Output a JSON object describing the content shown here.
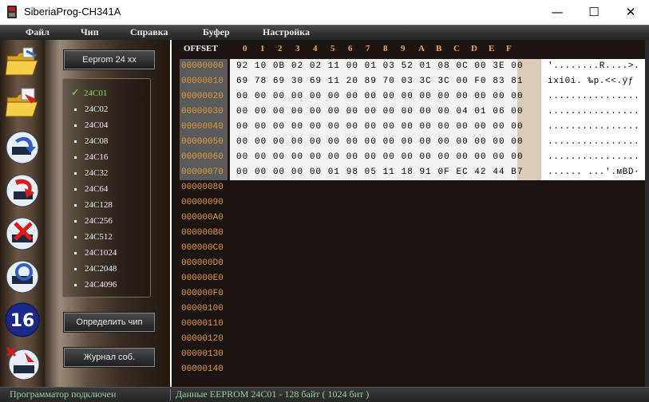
{
  "window": {
    "title": "SiberiaProg-CH341A"
  },
  "menu": [
    "Файл",
    "Чип",
    "Справка",
    "Буфер",
    "Настройка"
  ],
  "toolbar_icons": [
    "open-folder-icon",
    "save-folder-icon",
    "read-chip-icon",
    "write-chip-icon",
    "erase-chip-icon",
    "verify-chip-icon",
    "hex-16-icon",
    "erase-write-icon"
  ],
  "panel": {
    "family_button": "Eeprom 24 xx",
    "detect_button": "Определить чип",
    "log_button": "Журнал соб.",
    "chips": [
      "24C01",
      "24C02",
      "24C04",
      "24C08",
      "24C16",
      "24C32",
      "24C64",
      "24C128",
      "24C256",
      "24C512",
      "24C1024",
      "24C2048",
      "24C4096"
    ],
    "selected_chip": "24C01"
  },
  "hex": {
    "offset_label": "OFFSET",
    "columns": [
      "0",
      "1",
      "2",
      "3",
      "4",
      "5",
      "6",
      "7",
      "8",
      "9",
      "A",
      "B",
      "C",
      "D",
      "E",
      "F"
    ],
    "addresses": [
      "00000000",
      "00000010",
      "00000020",
      "00000030",
      "00000040",
      "00000050",
      "00000060",
      "00000070",
      "00000080",
      "00000090",
      "000000A0",
      "000000B0",
      "000000C0",
      "000000D0",
      "000000E0",
      "000000F0",
      "00000100",
      "00000110",
      "00000120",
      "00000130",
      "00000140"
    ],
    "rows": [
      "92 10 0B 02 02 11 00 01 03 52 01 08 0C 00 3E 00",
      "69 78 69 30 69 11 20 89 70 03 3C 3C 00 F0 83 81",
      "00 00 00 00 00 00 00 00 00 00 00 00 00 00 00 00",
      "00 00 00 00 00 00 00 00 00 00 00 00 04 01 06 00",
      "00 00 00 00 00 00 00 00 00 00 00 00 00 00 00 00",
      "00 00 00 00 00 00 00 00 00 00 00 00 00 00 00 00",
      "00 00 00 00 00 00 00 00 00 00 00 00 00 00 00 00",
      "00 00 00 00 00 01 98 05 11 18 91 0F EC 42 44 B7"
    ],
    "ascii": [
      "'........R....>.",
      "ixi0i. ‰p.<<.ÿƒ",
      "................",
      "................",
      "................",
      "................",
      "................",
      "...... ...'.мBD·"
    ]
  },
  "status": {
    "left": "Программатор подключен",
    "right": "Данные EEPROM  24C01 - 128 байт ( 1024 бит )"
  }
}
